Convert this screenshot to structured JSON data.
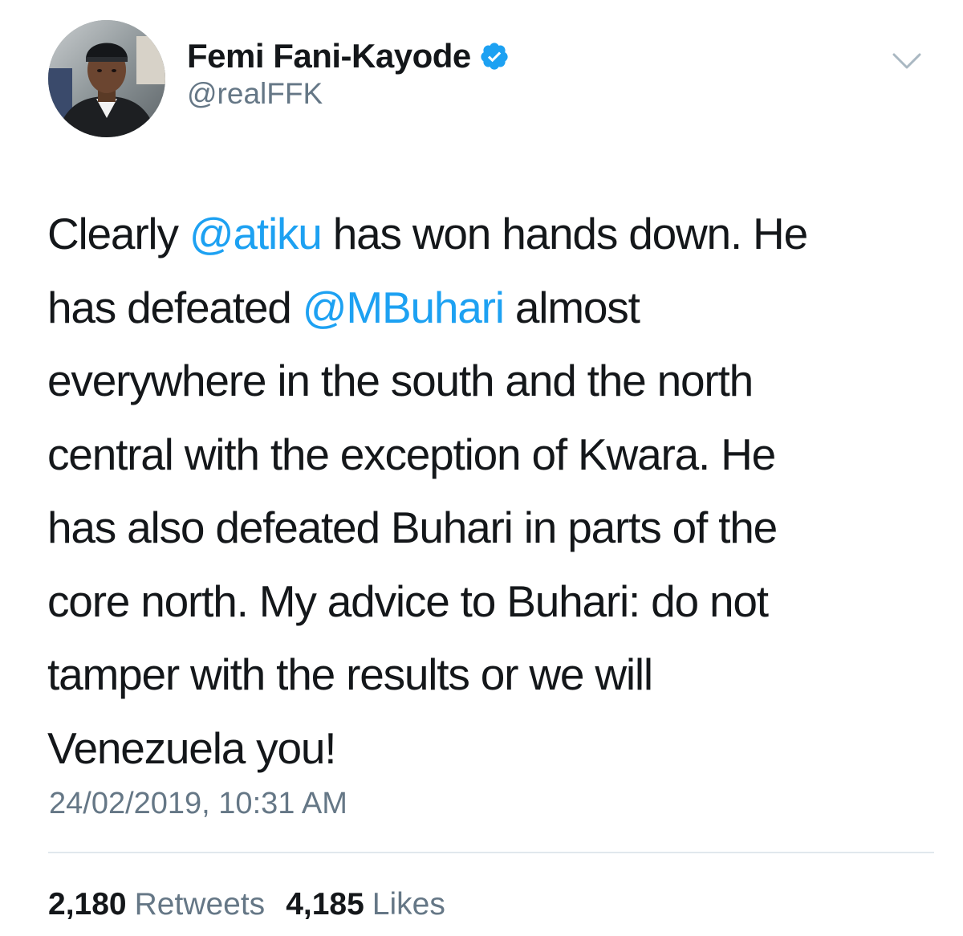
{
  "tweet": {
    "author": {
      "display_name": "Femi Fani-Kayode",
      "handle": "@realFFK",
      "verified": true,
      "avatar_icon": "profile-photo"
    },
    "menu_icon": "chevron-down-icon",
    "text_segments": [
      {
        "text": "Clearly ",
        "type": "text"
      },
      {
        "text": "@atiku",
        "type": "mention"
      },
      {
        "text": " has won hands down. He has defeated ",
        "type": "text"
      },
      {
        "text": "@MBuhari",
        "type": "mention"
      },
      {
        "text": " almost everywhere in the south and the north central with the exception of Kwara. He has also defeated Buhari in parts of the core north. My advice to Buhari: do not tamper with the results or we will Venezuela you!",
        "type": "text"
      }
    ],
    "lines": {
      "l1a": "Clearly ",
      "l1b": "@atiku",
      "l1c": " has won hands down. He",
      "l2a": "has defeated ",
      "l2b": "@MBuhari",
      "l2c": " almost",
      "l3": "everywhere in the south and the north",
      "l4": "central with the exception of Kwara. He",
      "l5": "has also defeated Buhari in parts of the",
      "l6": "core north. My advice to Buhari: do not",
      "l7": "tamper with the results or we will",
      "l8": "Venezuela you!"
    },
    "timestamp": "24/02/2019, 10:31 AM",
    "stats": {
      "retweets_count": "2,180",
      "retweets_label": "Retweets",
      "likes_count": "4,185",
      "likes_label": "Likes"
    }
  },
  "colors": {
    "link": "#1da1f2",
    "secondary_text": "#657786",
    "primary_text": "#14171a",
    "divider": "#e1e8ed",
    "verified_badge": "#1da1f2"
  }
}
